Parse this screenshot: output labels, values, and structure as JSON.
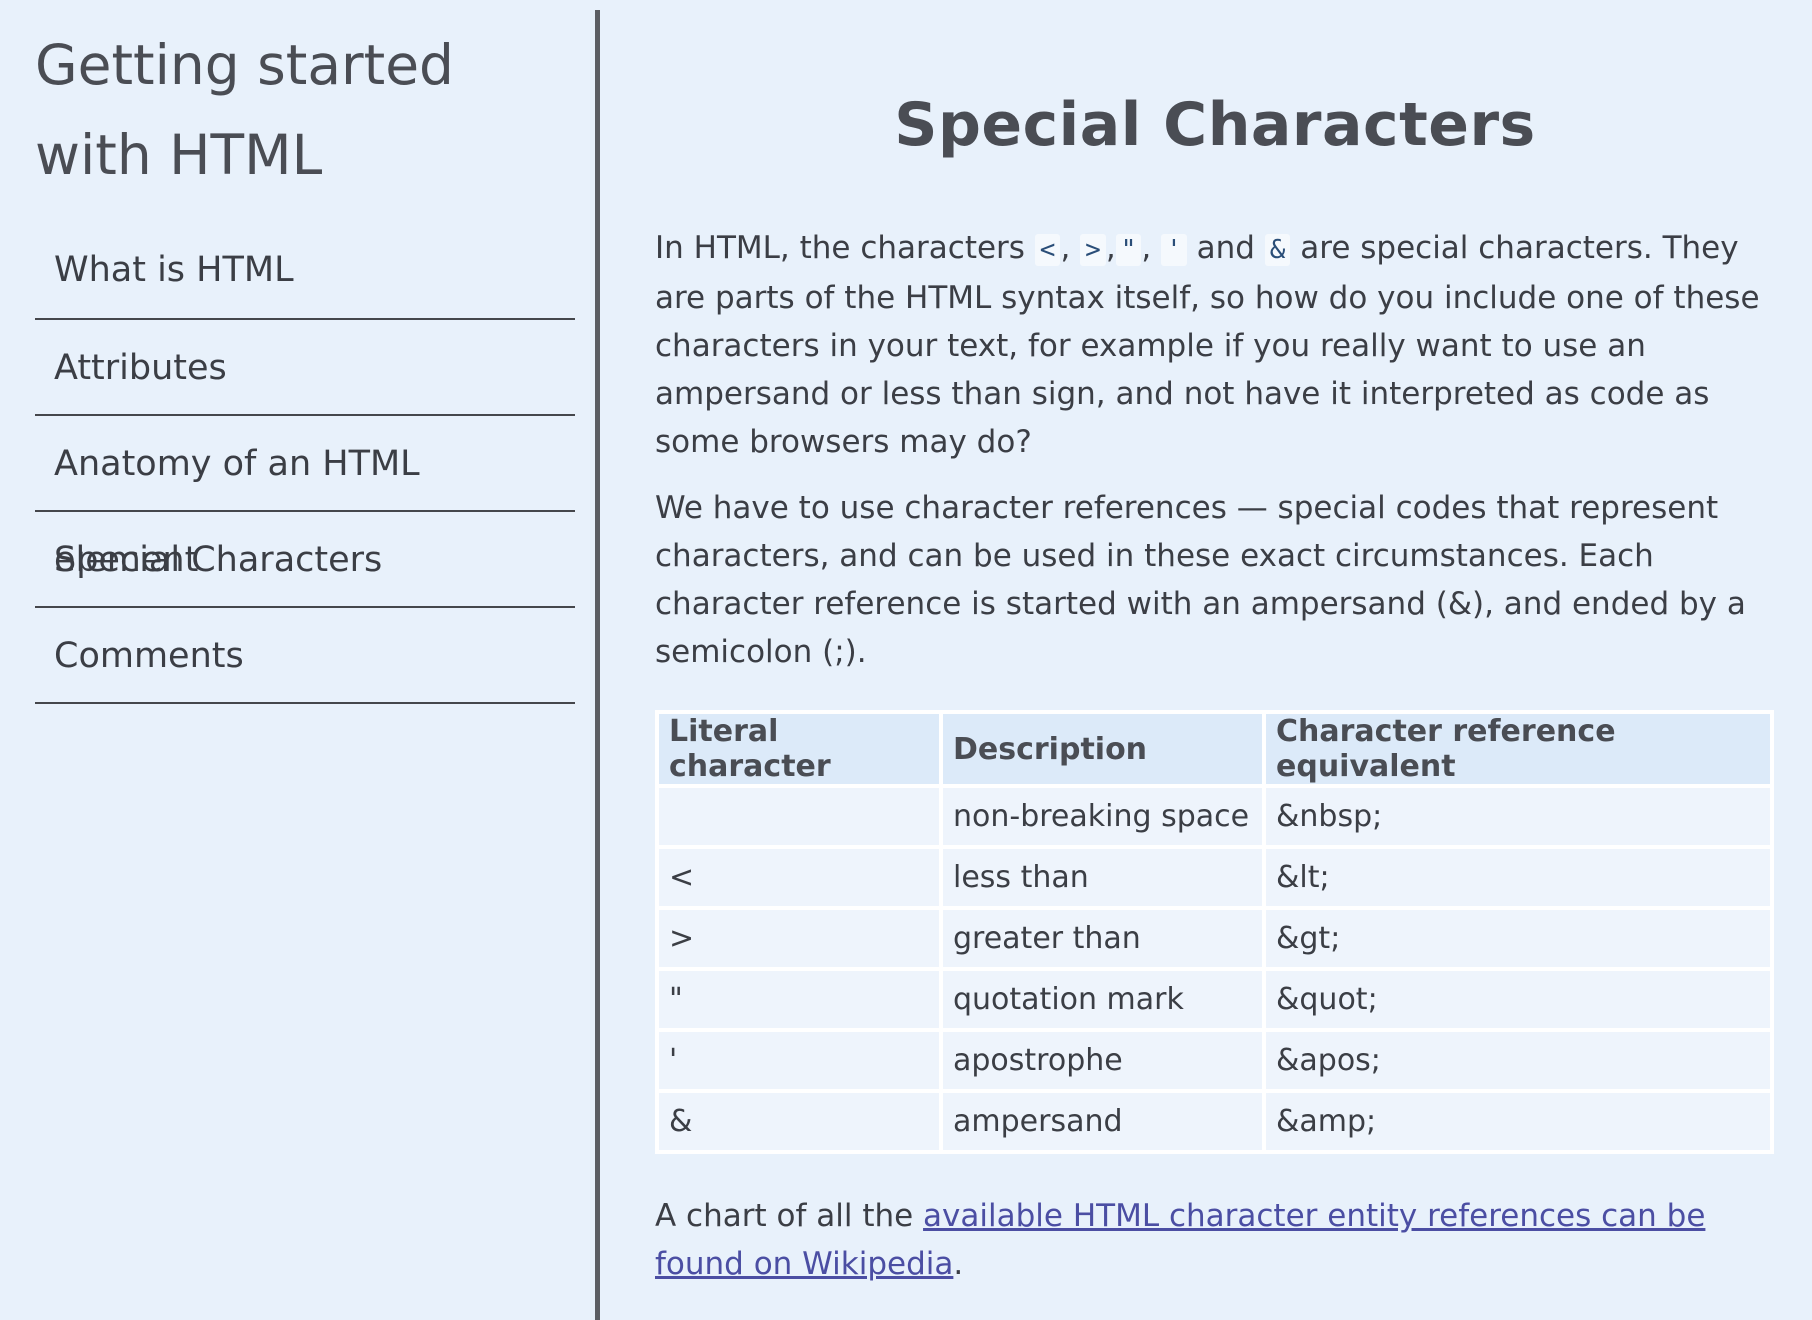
{
  "sidebar": {
    "title": "Getting started with HTML",
    "items": [
      {
        "label": "What is HTML"
      },
      {
        "label": "Attributes"
      },
      {
        "label": "Anatomy of an HTML element"
      },
      {
        "label": "Special Characters"
      },
      {
        "label": "Comments"
      }
    ]
  },
  "main": {
    "heading": "Special Characters",
    "intro": {
      "t1": "In HTML, the characters ",
      "c_lt": "<",
      "t2": ", ",
      "c_gt": ">",
      "t3": ",",
      "c_quot": "\"",
      "t4": ", ",
      "c_apos": "'",
      "t5": " and ",
      "c_amp": "&",
      "t6": " are special characters. They are parts of the HTML syntax itself, so how do you include one of these characters in your text, for example if you really want to use an ampersand or less than sign, and not have it interpreted as code as some browsers may do?"
    },
    "para2": "We have to use character references — special codes that represent characters, and can be used in these exact circumstances. Each character reference is started with an ampersand (&), and ended by a semicolon (;).",
    "table": {
      "headers": [
        "Literal character",
        "Description",
        "Character reference equivalent"
      ],
      "rows": [
        [
          "",
          "non-breaking space",
          "&nbsp;"
        ],
        [
          "<",
          "less than",
          "&lt;"
        ],
        [
          ">",
          "greater than",
          "&gt;"
        ],
        [
          "\"",
          "quotation mark",
          "&quot;"
        ],
        [
          "'",
          "apostrophe",
          "&apos;"
        ],
        [
          "&",
          "ampersand",
          "&amp;"
        ]
      ]
    },
    "footer": {
      "text_before": "A chart of all the ",
      "link_text": "available HTML character entity references can be found on Wikipedia",
      "text_after": "."
    }
  },
  "colors": {
    "background": "#e8f1fb",
    "text": "#3b3e45",
    "link": "#4b4ea3",
    "table_header": "#dceaf9"
  }
}
